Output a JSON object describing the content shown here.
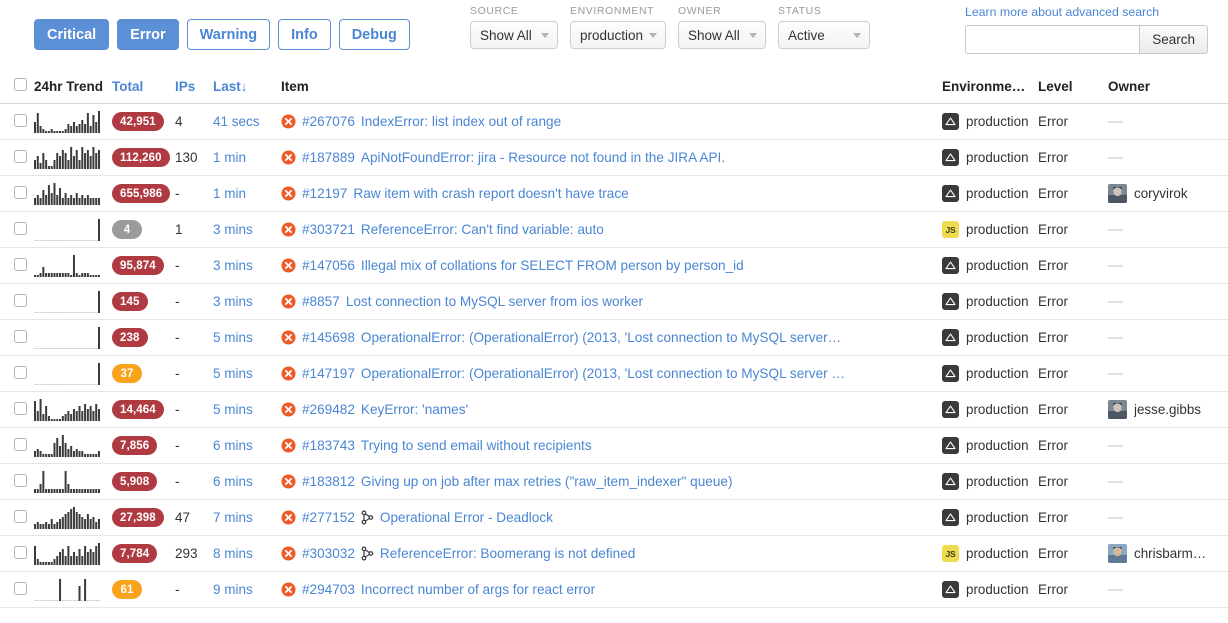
{
  "toolbar": {
    "levels": [
      {
        "label": "Critical",
        "active": true
      },
      {
        "label": "Error",
        "active": true
      },
      {
        "label": "Warning",
        "active": false
      },
      {
        "label": "Info",
        "active": false
      },
      {
        "label": "Debug",
        "active": false
      }
    ],
    "filters": [
      {
        "label": "SOURCE",
        "value": "Show All",
        "width": "w1"
      },
      {
        "label": "ENVIRONMENT",
        "value": "production",
        "width": "w2"
      },
      {
        "label": "OWNER",
        "value": "Show All",
        "width": "w3"
      },
      {
        "label": "STATUS",
        "value": "Active",
        "width": "w4"
      }
    ],
    "advanced_link": "Learn more about advanced search",
    "search_value": "",
    "search_placeholder": "",
    "search_button": "Search"
  },
  "table": {
    "columns": {
      "trend": "24hr Trend",
      "total": "Total",
      "ips": "IPs",
      "last": "Last",
      "last_sort_arrow": "↓",
      "item": "Item",
      "environment": "Environme…",
      "level": "Level",
      "owner": "Owner"
    },
    "rows": [
      {
        "trend": [
          5,
          9,
          3,
          2,
          1,
          1,
          2,
          1,
          1,
          1,
          1,
          2,
          4,
          3,
          5,
          3,
          4,
          6,
          4,
          9,
          3,
          8,
          5,
          10
        ],
        "total": "42,951",
        "total_color": "red",
        "ips": "4",
        "last": "41 secs",
        "item_id": "#267076",
        "item_title": "IndexError: list index out of range",
        "has_fork": false,
        "env_type": "py",
        "environment": "production",
        "level": "Error",
        "owner": null
      },
      {
        "trend": [
          3,
          4,
          2,
          5,
          3,
          1,
          1,
          3,
          5,
          4,
          6,
          5,
          3,
          7,
          4,
          6,
          3,
          7,
          5,
          6,
          4,
          7,
          5,
          6
        ],
        "total": "112,260",
        "total_color": "red",
        "ips": "130",
        "last": "1 min",
        "item_id": "#187889",
        "item_title": "ApiNotFoundError: jira - Resource not found in the JIRA API.",
        "has_fork": false,
        "env_type": "py",
        "environment": "production",
        "level": "Error",
        "owner": null
      },
      {
        "trend": [
          3,
          4,
          3,
          6,
          4,
          8,
          5,
          9,
          4,
          7,
          3,
          5,
          3,
          4,
          3,
          5,
          3,
          4,
          3,
          4,
          3,
          3,
          3,
          3
        ],
        "total": "655,986",
        "total_color": "red",
        "ips": "-",
        "last": "1 min",
        "item_id": "#12197",
        "item_title": "Raw item with crash report doesn't have trace",
        "has_fork": false,
        "env_type": "py",
        "environment": "production",
        "level": "Error",
        "owner": "coryvirok"
      },
      {
        "trend": [
          0,
          0,
          0,
          0,
          0,
          0,
          0,
          0,
          0,
          0,
          0,
          0,
          0,
          0,
          0,
          0,
          0,
          0,
          0,
          0,
          0,
          0,
          0,
          11
        ],
        "total": "4",
        "total_color": "gray",
        "ips": "1",
        "last": "3 mins",
        "item_id": "#303721",
        "item_title": "ReferenceError: Can't find variable: auto",
        "has_fork": false,
        "env_type": "js",
        "environment": "production",
        "level": "Error",
        "owner": null
      },
      {
        "trend": [
          1,
          1,
          2,
          5,
          2,
          2,
          2,
          2,
          2,
          2,
          2,
          2,
          2,
          1,
          11,
          2,
          1,
          2,
          2,
          2,
          1,
          1,
          1,
          1
        ],
        "total": "95,874",
        "total_color": "red",
        "ips": "-",
        "last": "3 mins",
        "item_id": "#147056",
        "item_title": "Illegal mix of collations for SELECT FROM person by person_id",
        "has_fork": false,
        "env_type": "py",
        "environment": "production",
        "level": "Error",
        "owner": null
      },
      {
        "trend": [
          0,
          0,
          0,
          0,
          0,
          0,
          0,
          0,
          0,
          0,
          0,
          0,
          0,
          0,
          0,
          0,
          0,
          0,
          0,
          0,
          0,
          0,
          0,
          11
        ],
        "total": "145",
        "total_color": "red",
        "ips": "-",
        "last": "3 mins",
        "item_id": "#8857",
        "item_title": "Lost connection to MySQL server from ios worker",
        "has_fork": false,
        "env_type": "py",
        "environment": "production",
        "level": "Error",
        "owner": null
      },
      {
        "trend": [
          0,
          0,
          0,
          0,
          0,
          0,
          0,
          0,
          0,
          0,
          0,
          0,
          0,
          0,
          0,
          0,
          0,
          0,
          0,
          0,
          0,
          0,
          0,
          11
        ],
        "total": "238",
        "total_color": "red",
        "ips": "-",
        "last": "5 mins",
        "item_id": "#145698",
        "item_title": "OperationalError: (OperationalError) (2013, 'Lost connection to MySQL server…",
        "has_fork": false,
        "env_type": "py",
        "environment": "production",
        "level": "Error",
        "owner": null
      },
      {
        "trend": [
          0,
          0,
          0,
          0,
          0,
          0,
          0,
          0,
          0,
          0,
          0,
          0,
          0,
          0,
          0,
          0,
          0,
          0,
          0,
          0,
          0,
          0,
          0,
          11
        ],
        "total": "37",
        "total_color": "orange",
        "ips": "-",
        "last": "5 mins",
        "item_id": "#147197",
        "item_title": "OperationalError: (OperationalError) (2013, 'Lost connection to MySQL server …",
        "has_fork": false,
        "env_type": "py",
        "environment": "production",
        "level": "Error",
        "owner": null
      },
      {
        "trend": [
          8,
          4,
          9,
          3,
          6,
          2,
          1,
          1,
          1,
          1,
          2,
          3,
          4,
          3,
          5,
          4,
          6,
          4,
          7,
          5,
          6,
          4,
          7,
          5
        ],
        "total": "14,464",
        "total_color": "red",
        "ips": "-",
        "last": "5 mins",
        "item_id": "#269482",
        "item_title": "KeyError: 'names'",
        "has_fork": false,
        "env_type": "py",
        "environment": "production",
        "level": "Error",
        "owner": "jesse.gibbs"
      },
      {
        "trend": [
          2,
          3,
          2,
          1,
          1,
          1,
          1,
          5,
          7,
          4,
          8,
          5,
          3,
          4,
          2,
          3,
          2,
          2,
          1,
          1,
          1,
          1,
          1,
          2
        ],
        "total": "7,856",
        "total_color": "red",
        "ips": "-",
        "last": "6 mins",
        "item_id": "#183743",
        "item_title": "Trying to send email without recipients",
        "has_fork": false,
        "env_type": "py",
        "environment": "production",
        "level": "Error",
        "owner": null
      },
      {
        "trend": [
          1,
          1,
          2,
          5,
          1,
          1,
          1,
          1,
          1,
          1,
          1,
          5,
          2,
          1,
          1,
          1,
          1,
          1,
          1,
          1,
          1,
          1,
          1,
          1
        ],
        "total": "5,908",
        "total_color": "red",
        "ips": "-",
        "last": "6 mins",
        "item_id": "#183812",
        "item_title": "Giving up on job after max retries (\"raw_item_indexer\" queue)",
        "has_fork": false,
        "env_type": "py",
        "environment": "production",
        "level": "Error",
        "owner": null
      },
      {
        "trend": [
          2,
          3,
          2,
          2,
          3,
          2,
          4,
          2,
          3,
          4,
          5,
          6,
          7,
          8,
          9,
          7,
          6,
          5,
          4,
          6,
          4,
          5,
          3,
          4
        ],
        "total": "27,398",
        "total_color": "red",
        "ips": "47",
        "last": "7 mins",
        "item_id": "#277152",
        "item_title": "Operational Error - Deadlock",
        "has_fork": true,
        "env_type": "py",
        "environment": "production",
        "level": "Error",
        "owner": null
      },
      {
        "trend": [
          6,
          2,
          1,
          1,
          1,
          1,
          1,
          2,
          3,
          4,
          5,
          3,
          6,
          3,
          4,
          3,
          5,
          3,
          6,
          4,
          5,
          4,
          6,
          7
        ],
        "total": "7,784",
        "total_color": "red",
        "ips": "293",
        "last": "8 mins",
        "item_id": "#303032",
        "item_title": "ReferenceError: Boomerang is not defined",
        "has_fork": true,
        "env_type": "js",
        "environment": "production",
        "level": "Error",
        "owner": "chrisbarm…"
      },
      {
        "trend": [
          0,
          0,
          0,
          0,
          0,
          0,
          0,
          0,
          0,
          6,
          0,
          0,
          0,
          0,
          0,
          0,
          4,
          0,
          6,
          0,
          0,
          0,
          0,
          0
        ],
        "total": "61",
        "total_color": "orange",
        "ips": "-",
        "last": "9 mins",
        "item_id": "#294703",
        "item_title": "Incorrect number of args for react error",
        "has_fork": false,
        "env_type": "py",
        "environment": "production",
        "level": "Error",
        "owner": null
      }
    ]
  },
  "colors": {
    "accent_blue": "#4a86d4",
    "badge_red": "#b03a42",
    "badge_orange": "#f9a21b",
    "badge_gray": "#9b9b9b",
    "error_icon": "#f05a28",
    "js_yellow": "#f0db4f"
  }
}
